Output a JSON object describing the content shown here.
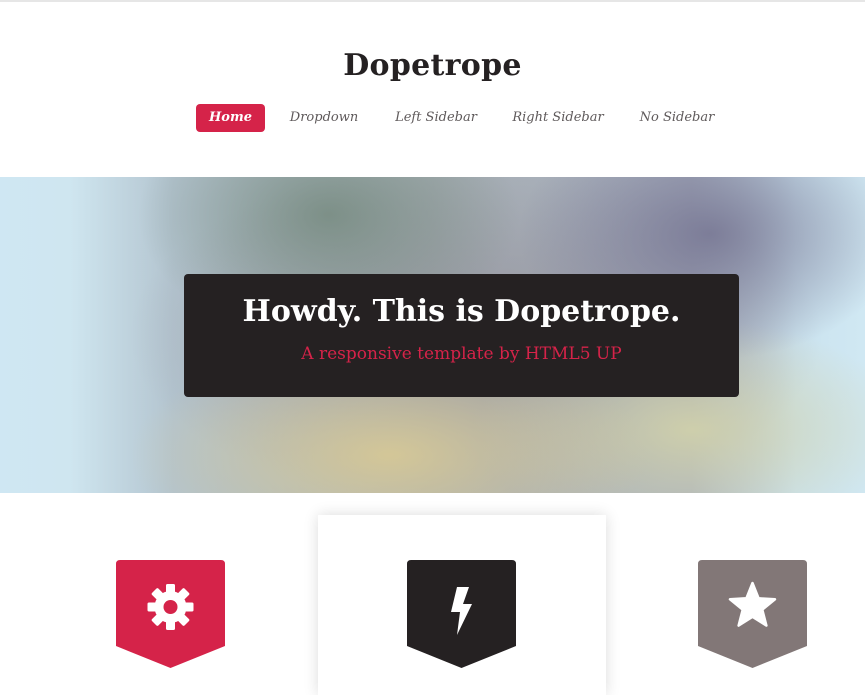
{
  "header": {
    "logo": "Dopetrope",
    "nav": [
      {
        "label": "Home",
        "active": true
      },
      {
        "label": "Dropdown",
        "active": false
      },
      {
        "label": "Left Sidebar",
        "active": false
      },
      {
        "label": "Right Sidebar",
        "active": false
      },
      {
        "label": "No Sidebar",
        "active": false
      }
    ]
  },
  "banner": {
    "title": "Howdy. This is Dopetrope.",
    "subtitle": "A responsive template by HTML5 UP"
  },
  "features": [
    {
      "icon": "gear-icon",
      "color": "#d52349"
    },
    {
      "icon": "bolt-icon",
      "color": "#252122"
    },
    {
      "icon": "star-icon",
      "color": "#827777"
    }
  ],
  "colors": {
    "accent": "#d52349",
    "dark": "#252122",
    "muted": "#827777"
  }
}
